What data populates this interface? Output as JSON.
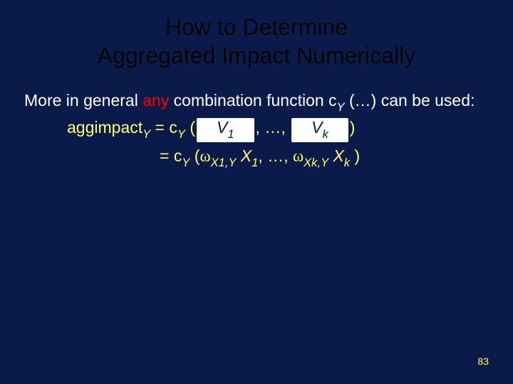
{
  "title_line1": "How to Determine",
  "title_line2": "Aggregated Impact Numerically",
  "lead_pre": "More in general ",
  "lead_any": "any",
  "lead_post": " combination function c",
  "lead_postsub": "Y",
  "lead_tail": " (…) can be used:",
  "eq_lhs": "aggimpact",
  "eq_lhs_sub": "Y",
  "eq_eq": " = c",
  "eq_csub": "Y",
  "eq_open": " (",
  "pill1_v": "V",
  "pill1_sub": "1",
  "eq_mid": ", …, ",
  "pillk_v": "V",
  "pillk_sub": "k",
  "eq_close": ")",
  "row2_pre": "= c",
  "row2_csub": "Y",
  "row2_open": " (",
  "omega": "ω",
  "x1a": "X",
  "x1a_sub": "1",
  "comma1": ",",
  "ysub": "Y",
  "sp": " ",
  "x1b": "X",
  "x1b_sub": "1",
  "row2_mid": ", …, ",
  "xka": "X",
  "xka_sub": "k",
  "xkb": "X",
  "xkb_sub": "k",
  "row2_close": " )",
  "pagenum": "83"
}
